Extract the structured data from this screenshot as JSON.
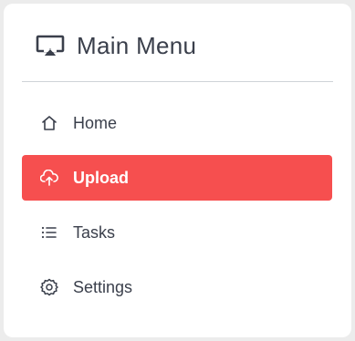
{
  "menu": {
    "title": "Main Menu",
    "icon": "airplay-icon",
    "items": [
      {
        "label": "Home",
        "icon": "home-icon",
        "active": false
      },
      {
        "label": "Upload",
        "icon": "cloud-upload-icon",
        "active": true
      },
      {
        "label": "Tasks",
        "icon": "list-icon",
        "active": false
      },
      {
        "label": "Settings",
        "icon": "gear-icon",
        "active": false
      }
    ]
  },
  "colors": {
    "accent": "#f64f4f",
    "text": "#3a3f4b",
    "background": "#ececec",
    "card": "#ffffff"
  }
}
